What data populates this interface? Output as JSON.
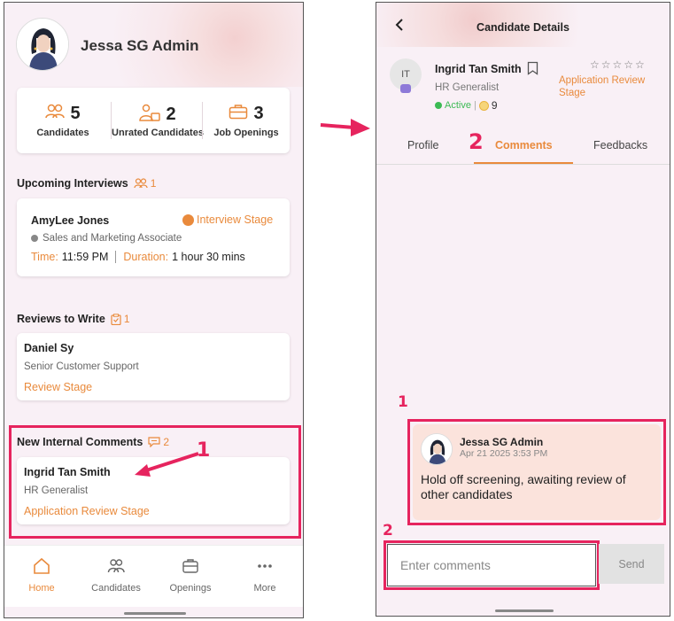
{
  "left": {
    "user": {
      "name": "Jessa SG Admin"
    },
    "stats": [
      {
        "value": "5",
        "label": "Candidates",
        "icon": "users-icon"
      },
      {
        "value": "2",
        "label": "Unrated Candidates",
        "icon": "user-rating-icon"
      },
      {
        "value": "3",
        "label": "Job Openings",
        "icon": "briefcase-icon"
      }
    ],
    "upcoming": {
      "title": "Upcoming Interviews",
      "count": "1",
      "card": {
        "name": "AmyLee Jones",
        "stage": "Interview Stage",
        "role": "Sales and Marketing Associate",
        "time_label": "Time:",
        "time": "11:59 PM",
        "duration_label": "Duration:",
        "duration": "1 hour 30 mins"
      }
    },
    "reviews": {
      "title": "Reviews to Write",
      "count": "1",
      "card": {
        "name": "Daniel Sy",
        "role": "Senior Customer Support",
        "stage": "Review Stage"
      }
    },
    "comments": {
      "title": "New Internal Comments",
      "count": "2",
      "card": {
        "name": "Ingrid Tan Smith",
        "role": "HR Generalist",
        "stage": "Application Review Stage"
      }
    },
    "nav": [
      {
        "label": "Home",
        "active": true
      },
      {
        "label": "Candidates",
        "active": false
      },
      {
        "label": "Openings",
        "active": false
      },
      {
        "label": "More",
        "active": false
      }
    ],
    "annotation": "1"
  },
  "right": {
    "title": "Candidate Details",
    "candidate": {
      "initials": "IT",
      "name": "Ingrid Tan Smith",
      "role": "HR Generalist",
      "status": "Active",
      "points": "9",
      "stars": "☆☆☆☆☆",
      "stage": "Application Review Stage"
    },
    "tabs": [
      "Profile",
      "Comments",
      "Feedbacks"
    ],
    "active_tab": "Comments",
    "tab_annotation": "2",
    "comment": {
      "author": "Jessa SG Admin",
      "time": "Apr 21 2025 3:53 PM",
      "text": "Hold off screening, awaiting review of other candidates"
    },
    "comment_annotation": "1",
    "input": {
      "placeholder": "Enter comments",
      "annotation": "2"
    },
    "send_label": "Send"
  },
  "colors": {
    "accent": "#e98a3c",
    "highlight": "#e6245e",
    "active_status": "#3cba54"
  }
}
